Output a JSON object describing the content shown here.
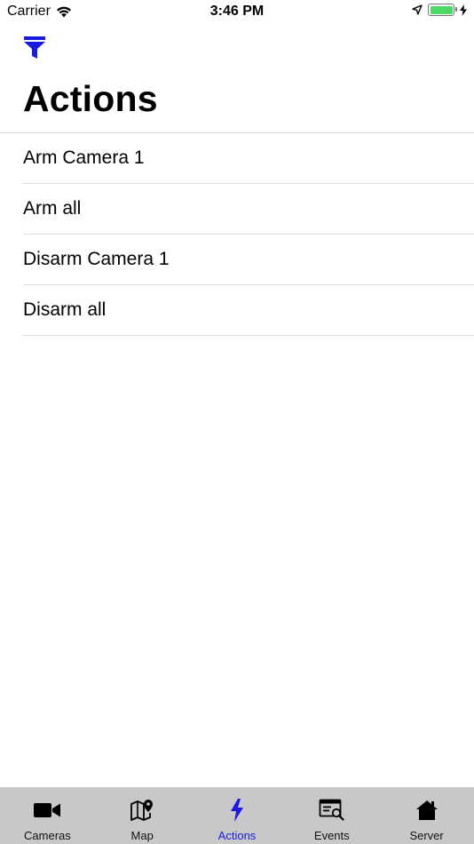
{
  "status_bar": {
    "carrier": "Carrier",
    "time": "3:46 PM",
    "battery_level": 1.0
  },
  "header": {
    "title": "Actions",
    "filter_icon": "filter-icon"
  },
  "actions": [
    {
      "label": "Arm Camera 1"
    },
    {
      "label": "Arm all"
    },
    {
      "label": "Disarm Camera 1"
    },
    {
      "label": "Disarm all"
    }
  ],
  "tab_bar": {
    "active": "Actions",
    "tabs": [
      {
        "label": "Cameras",
        "icon": "video-camera-icon"
      },
      {
        "label": "Map",
        "icon": "map-pin-icon"
      },
      {
        "label": "Actions",
        "icon": "lightning-bolt-icon"
      },
      {
        "label": "Events",
        "icon": "events-search-icon"
      },
      {
        "label": "Server",
        "icon": "house-icon"
      }
    ]
  },
  "colors": {
    "accent": "#1a1ae0",
    "tab_bar_background": "#c8c8c8",
    "battery": "#4cd964"
  }
}
